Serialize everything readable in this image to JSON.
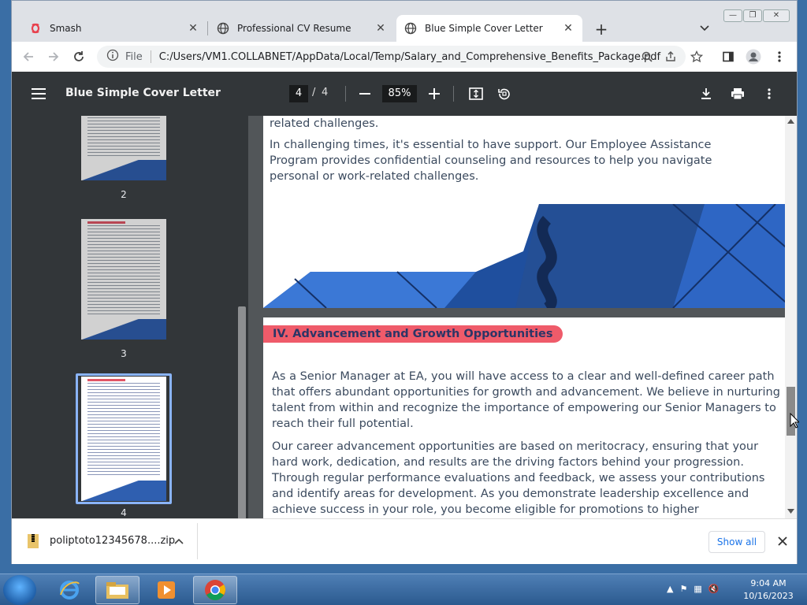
{
  "browser": {
    "tabs": [
      {
        "title": "Smash",
        "icon": "smash-logo-icon"
      },
      {
        "title": "Professional CV Resume",
        "icon": "globe-icon"
      },
      {
        "title": "Blue Simple Cover Letter",
        "icon": "globe-icon",
        "active": true
      }
    ],
    "new_tab": "+",
    "address": {
      "scheme_label": "File",
      "url": "C:/Users/VM1.COLLABNET/AppData/Local/Temp/Salary_and_Comprehensive_Benefits_Package.pdf"
    }
  },
  "pdf": {
    "title": "Blue Simple Cover Letter",
    "current_page": "4",
    "page_sep": "/",
    "total_pages": "4",
    "zoom": "85%",
    "thumbnails": [
      {
        "label": "2"
      },
      {
        "label": "3"
      },
      {
        "label": "4"
      }
    ],
    "page3": {
      "lead": "related challenges.",
      "para": "In challenging times, it's essential to have support. Our Employee Assistance Program provides confidential counseling and resources to help you navigate personal or work-related challenges."
    },
    "page4": {
      "heading": "IV. Advancement and Growth Opportunities",
      "p1": "As a Senior Manager at EA, you will have access to a clear and well-defined career path that offers abundant opportunities for growth and advancement. We believe in nurturing talent from within and recognize the importance of empowering our Senior Managers to reach their full potential.",
      "p2": "Our career advancement opportunities are based on meritocracy, ensuring that your hard work, dedication, and results are the driving factors behind your progression. Through regular performance evaluations and feedback, we assess your contributions and identify areas for development. As you demonstrate leadership excellence and achieve success in your role, you become eligible for promotions to higher management positions."
    }
  },
  "downloads": {
    "file": "poliptoto12345678....zip",
    "show_all": "Show all"
  },
  "taskbar": {
    "time": "9:04 AM",
    "date": "10/16/2023"
  },
  "colors": {
    "accent": "#2f5fb0",
    "heading_bg": "#ef5b6a",
    "pdf_toolbar": "#323639"
  }
}
